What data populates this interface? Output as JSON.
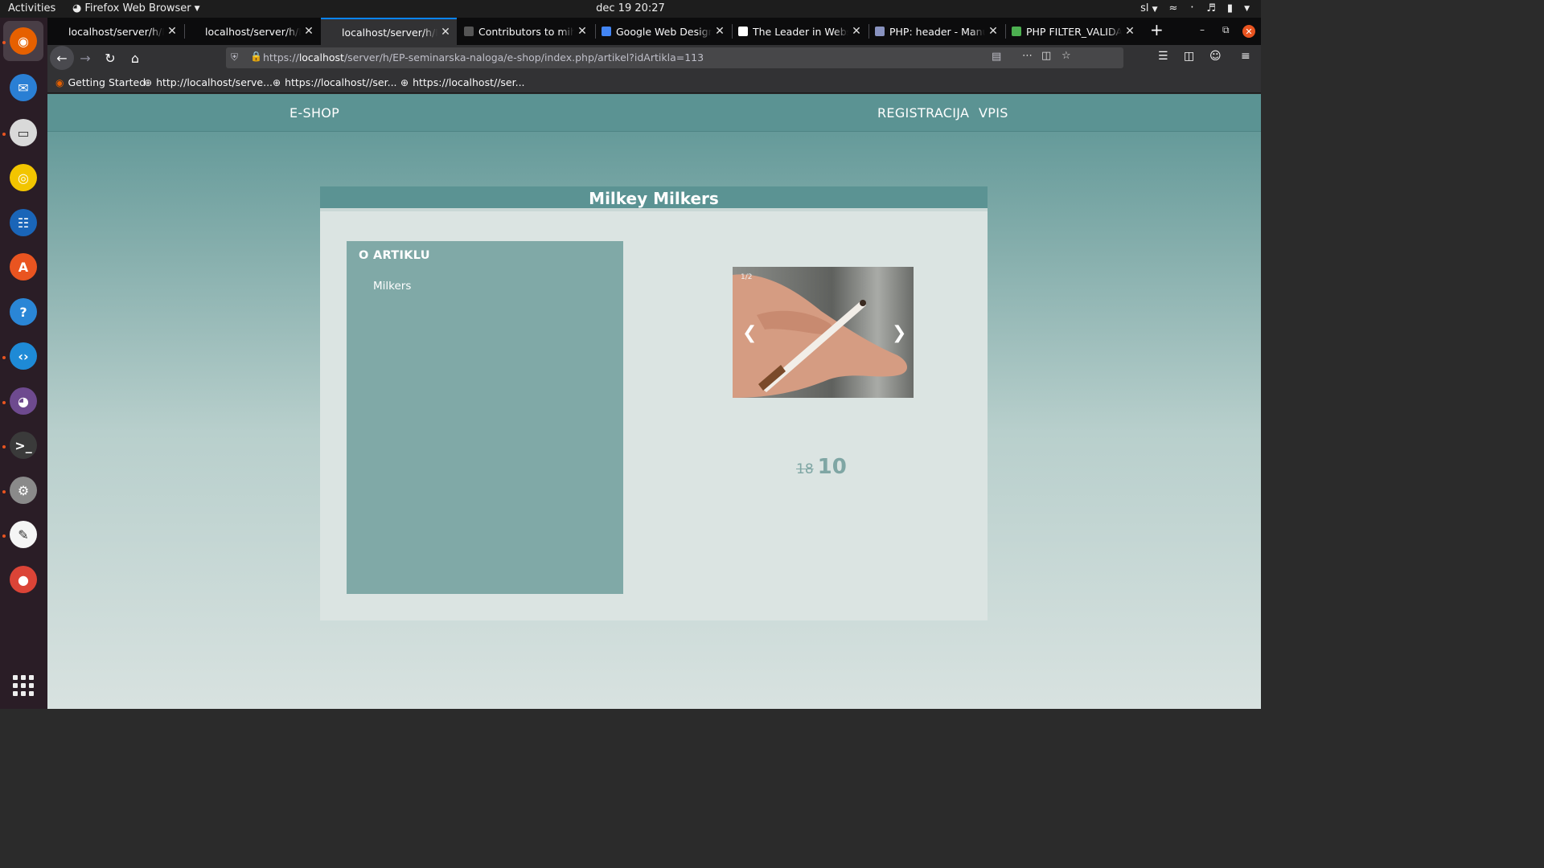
{
  "system": {
    "activities": "Activities",
    "app_name": "Firefox Web Browser",
    "clock": "dec 19  20:27",
    "keyboard_layout": "sl"
  },
  "dock": [
    {
      "name": "firefox",
      "active": true,
      "running": true,
      "color": "#e66000"
    },
    {
      "name": "thunderbird",
      "running": false,
      "color": "#2a7fd4"
    },
    {
      "name": "files",
      "running": true,
      "color": "#d9d9d9"
    },
    {
      "name": "rhythmbox",
      "running": false,
      "color": "#f2c500"
    },
    {
      "name": "libreoffice-writer",
      "running": false,
      "color": "#1a65b8"
    },
    {
      "name": "software",
      "running": false,
      "color": "#e95420"
    },
    {
      "name": "help",
      "running": false,
      "color": "#2a86d6"
    },
    {
      "name": "vscode",
      "running": true,
      "color": "#1e8ad6"
    },
    {
      "name": "github-desktop",
      "running": true,
      "color": "#6e4a8f"
    },
    {
      "name": "terminal",
      "running": true,
      "color": "#3a3a3a"
    },
    {
      "name": "settings",
      "running": true,
      "color": "#8a8a8a"
    },
    {
      "name": "text-editor",
      "running": true,
      "color": "#f5f5f5"
    },
    {
      "name": "chrome",
      "running": false,
      "color": "#db4437"
    }
  ],
  "browser": {
    "tabs": [
      {
        "title": "localhost/server/h/EP-se",
        "favicon_color": "#0c0c0d",
        "selected": false
      },
      {
        "title": "localhost/server/h/EP-se",
        "favicon_color": "#0c0c0d",
        "selected": false
      },
      {
        "title": "localhost/server/h/EP-se",
        "favicon_color": "#323234",
        "selected": true
      },
      {
        "title": "Contributors to miha",
        "favicon_color": "#555555",
        "selected": false
      },
      {
        "title": "Google Web Designe",
        "favicon_color": "#4285f4",
        "selected": false
      },
      {
        "title": "The Leader in Websit",
        "favicon_color": "#ffffff",
        "selected": false
      },
      {
        "title": "PHP: header - Manual",
        "favicon_color": "#8892bf",
        "selected": false
      },
      {
        "title": "PHP FILTER_VALIDAT",
        "favicon_color": "#4caf50",
        "selected": false
      }
    ],
    "url_prefix": "https://",
    "url_host": "localhost",
    "url_path": "/server/h/EP-seminarska-naloga/e-shop/index.php/artikel?idArtikla=113",
    "bookmarks": [
      {
        "label": "Getting Started"
      },
      {
        "label": "http://localhost/serve..."
      },
      {
        "label": "https://localhost//ser..."
      },
      {
        "label": "https://localhost//ser..."
      }
    ]
  },
  "site": {
    "brand": "E-SHOP",
    "register": "REGISTRACIJA",
    "login": "VPIS",
    "product": {
      "title": "Milkey Milkers",
      "about_heading": "O ARTIKLU",
      "description": "Milkers",
      "image_counter": "1/2",
      "old_price": "18",
      "new_price": "10"
    }
  },
  "colors": {
    "accent": "#5b9393",
    "panel": "#80a9a7",
    "price": "#7fa6a4"
  }
}
